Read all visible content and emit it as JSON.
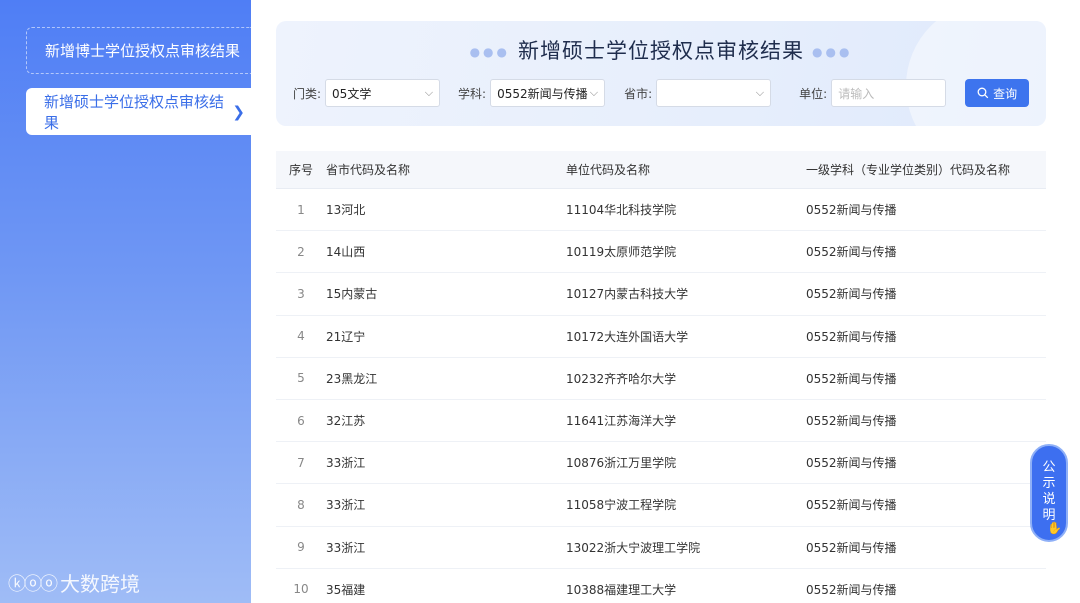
{
  "sidebar": {
    "items": [
      {
        "label": "新增博士学位授权点审核结果"
      },
      {
        "label": "新增硕士学位授权点审核结果"
      }
    ]
  },
  "header": {
    "title": "新增硕士学位授权点审核结果"
  },
  "filters": {
    "category_label": "门类:",
    "category_value": "05文学",
    "subject_label": "学科:",
    "subject_value": "0552新闻与传播",
    "province_label": "省市:",
    "province_value": "",
    "unit_label": "单位:",
    "unit_placeholder": "请输入",
    "query_label": "查询"
  },
  "table": {
    "headers": [
      "序号",
      "省市代码及名称",
      "单位代码及名称",
      "一级学科（专业学位类别）代码及名称"
    ],
    "rows": [
      {
        "idx": "1",
        "prov": "13河北",
        "unit": "11104华北科技学院",
        "subj": "0552新闻与传播"
      },
      {
        "idx": "2",
        "prov": "14山西",
        "unit": "10119太原师范学院",
        "subj": "0552新闻与传播"
      },
      {
        "idx": "3",
        "prov": "15内蒙古",
        "unit": "10127内蒙古科技大学",
        "subj": "0552新闻与传播"
      },
      {
        "idx": "4",
        "prov": "21辽宁",
        "unit": "10172大连外国语大学",
        "subj": "0552新闻与传播"
      },
      {
        "idx": "5",
        "prov": "23黑龙江",
        "unit": "10232齐齐哈尔大学",
        "subj": "0552新闻与传播"
      },
      {
        "idx": "6",
        "prov": "32江苏",
        "unit": "11641江苏海洋大学",
        "subj": "0552新闻与传播"
      },
      {
        "idx": "7",
        "prov": "33浙江",
        "unit": "10876浙江万里学院",
        "subj": "0552新闻与传播"
      },
      {
        "idx": "8",
        "prov": "33浙江",
        "unit": "11058宁波工程学院",
        "subj": "0552新闻与传播"
      },
      {
        "idx": "9",
        "prov": "33浙江",
        "unit": "13022浙大宁波理工学院",
        "subj": "0552新闻与传播"
      },
      {
        "idx": "10",
        "prov": "35福建",
        "unit": "10388福建理工大学",
        "subj": "0552新闻与传播"
      }
    ]
  },
  "float_button": {
    "chars": [
      "公",
      "示",
      "说",
      "明"
    ]
  },
  "watermark": {
    "text": "大数跨境"
  },
  "icons": {
    "chevron": "chevron-right-icon",
    "dropdown": "chevron-down-icon",
    "search": "search-icon"
  }
}
